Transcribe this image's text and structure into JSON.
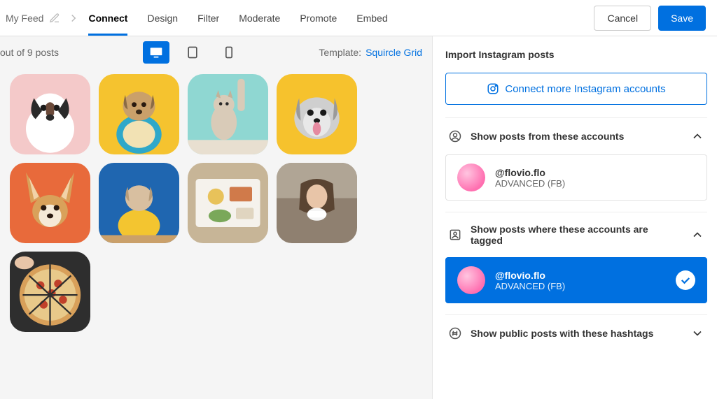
{
  "topbar": {
    "feed_name": "My Feed",
    "tabs": [
      "Connect",
      "Design",
      "Filter",
      "Moderate",
      "Promote",
      "Embed"
    ],
    "active_tab_index": 0,
    "cancel_label": "Cancel",
    "save_label": "Save"
  },
  "preview": {
    "post_count_text": "out of 9 posts",
    "template_label": "Template:",
    "template_name": "Squircle Grid",
    "tiles": [
      {
        "bg": "#f7cfcf",
        "subject": "dog-face-bw"
      },
      {
        "bg": "#f6c22d",
        "subject": "dog-shirt"
      },
      {
        "bg": "#8fd7d2",
        "subject": "cat-paw-up"
      },
      {
        "bg": "#f6c22d",
        "subject": "dog-gray-tongue"
      },
      {
        "bg": "#e86a3b",
        "subject": "dog-big-ears"
      },
      {
        "bg": "#1f66b0",
        "subject": "dog-yellow-hoodie"
      },
      {
        "bg": "#cbb79a",
        "subject": "breakfast-plate"
      },
      {
        "bg": "#9a8a7a",
        "subject": "woman-coffee"
      },
      {
        "bg": "#3a3a3a",
        "subject": "pizza-topdown"
      }
    ]
  },
  "sidebar": {
    "title": "Import Instagram posts",
    "connect_label": "Connect more Instagram accounts",
    "sections": {
      "accounts": {
        "title": "Show posts from these accounts",
        "expanded": true,
        "items": [
          {
            "handle": "@flovio.flo",
            "subtitle": "ADVANCED (FB)",
            "selected": false
          }
        ]
      },
      "tagged": {
        "title": "Show posts where these accounts are tagged",
        "expanded": true,
        "items": [
          {
            "handle": "@flovio.flo",
            "subtitle": "ADVANCED (FB)",
            "selected": true
          }
        ]
      },
      "hashtags": {
        "title": "Show public posts with these hashtags",
        "expanded": false
      }
    }
  }
}
